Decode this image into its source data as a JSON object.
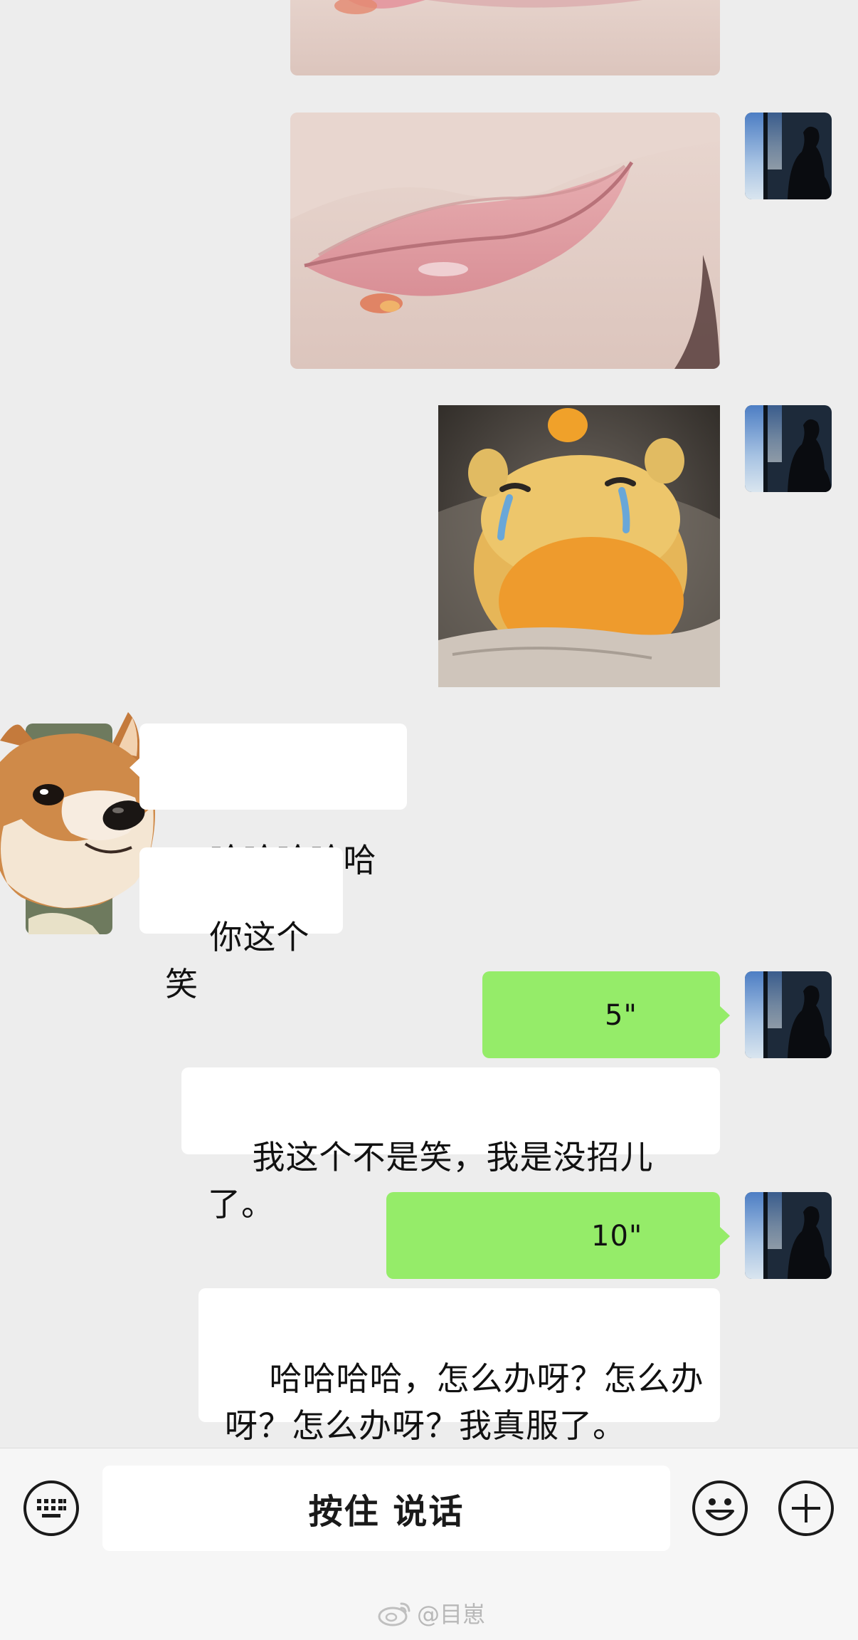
{
  "messages": {
    "incoming_1": "哈哈哈哈哈哈",
    "incoming_2": "你这个笑",
    "voice_1_duration": "5\"",
    "outgoing_1": "我这个不是笑，我是没招儿了。",
    "voice_2_duration": "10\"",
    "outgoing_2": "哈哈哈哈，怎么办呀？怎么办\n呀？怎么办呀？我真服了。"
  },
  "input_bar": {
    "talk_button": "按住 说话",
    "left_icon": "keyboard-icon",
    "emoji_icon": "emoji-icon",
    "more_icon": "plus-icon"
  },
  "watermark": {
    "text": "@目崽",
    "icon": "weibo-icon"
  },
  "colors": {
    "background": "#ededed",
    "outgoing_bubble": "#95ec69",
    "incoming_bubble": "#ffffff",
    "input_bar": "#f6f6f6"
  }
}
